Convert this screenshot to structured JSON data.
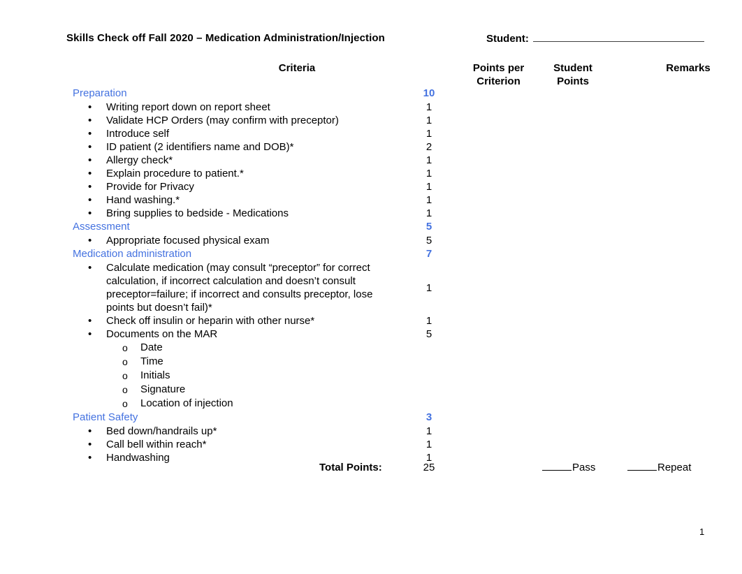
{
  "document": {
    "title": "Skills Check off Fall 2020 – Medication Administration/Injection",
    "student_label": "Student:",
    "page_number": "1"
  },
  "colors": {
    "section_blue": "#4472e0",
    "text": "#000000"
  },
  "headers": {
    "criteria": "Criteria",
    "points_per_criterion": "Points per\nCriterion",
    "points_per_criterion_line1": "Points per",
    "points_per_criterion_line2": "Criterion",
    "student_points_line1": "Student",
    "student_points_line2": "Points",
    "remarks": "Remarks"
  },
  "sections": [
    {
      "name": "Preparation",
      "points": "10",
      "items": [
        {
          "bullet": "•",
          "text": "Writing report down on report sheet",
          "points": "1"
        },
        {
          "bullet": "•",
          "text": "Validate HCP Orders (may confirm with preceptor)",
          "points": "1"
        },
        {
          "bullet": "•",
          "text": "Introduce self",
          "points": "1"
        },
        {
          "bullet": "•",
          "text": "ID patient (2 identifiers name and DOB)*",
          "points": "2"
        },
        {
          "bullet": "•",
          "text": "Allergy check*",
          "points": "1"
        },
        {
          "bullet": "•",
          "text": "Explain procedure to patient.*",
          "points": "1"
        },
        {
          "bullet": "•",
          "text": "Provide for Privacy",
          "points": "1"
        },
        {
          "bullet": "•",
          "text": "Hand washing.*",
          "points": "1"
        },
        {
          "bullet": "•",
          "text": "Bring supplies to bedside - Medications",
          "points": "1"
        }
      ]
    },
    {
      "name": "Assessment",
      "points": "5",
      "items": [
        {
          "bullet": "•",
          "text": "Appropriate focused physical exam",
          "points": "5"
        }
      ]
    },
    {
      "name": "Medication administration",
      "points": "7",
      "items": [
        {
          "bullet": "•",
          "text": "Calculate medication (may consult “preceptor” for correct calculation, if incorrect calculation and doesn’t consult preceptor=failure; if incorrect and consults preceptor, lose points but doesn’t fail)*",
          "points": "1"
        },
        {
          "bullet": "•",
          "text": "Check off insulin or heparin with other nurse*",
          "points": "1"
        },
        {
          "bullet": "•",
          "text": "Documents on the MAR",
          "points": "5",
          "subitems": [
            {
              "marker": "o",
              "text": "Date"
            },
            {
              "marker": "o",
              "text": "Time"
            },
            {
              "marker": "o",
              "text": "Initials"
            },
            {
              "marker": "o",
              "text": "Signature"
            },
            {
              "marker": "o",
              "text": "Location of injection"
            }
          ]
        }
      ]
    },
    {
      "name": "Patient Safety",
      "points": "3",
      "items": [
        {
          "bullet": "•",
          "text": "Bed down/handrails up*",
          "points": "1"
        },
        {
          "bullet": "•",
          "text": "Call bell within reach*",
          "points": "1"
        },
        {
          "bullet": "•",
          "text": "Handwashing",
          "points": "1"
        }
      ]
    }
  ],
  "total": {
    "label": "Total Points:",
    "value": "25",
    "pass_label": "Pass",
    "repeat_label": "Repeat"
  }
}
